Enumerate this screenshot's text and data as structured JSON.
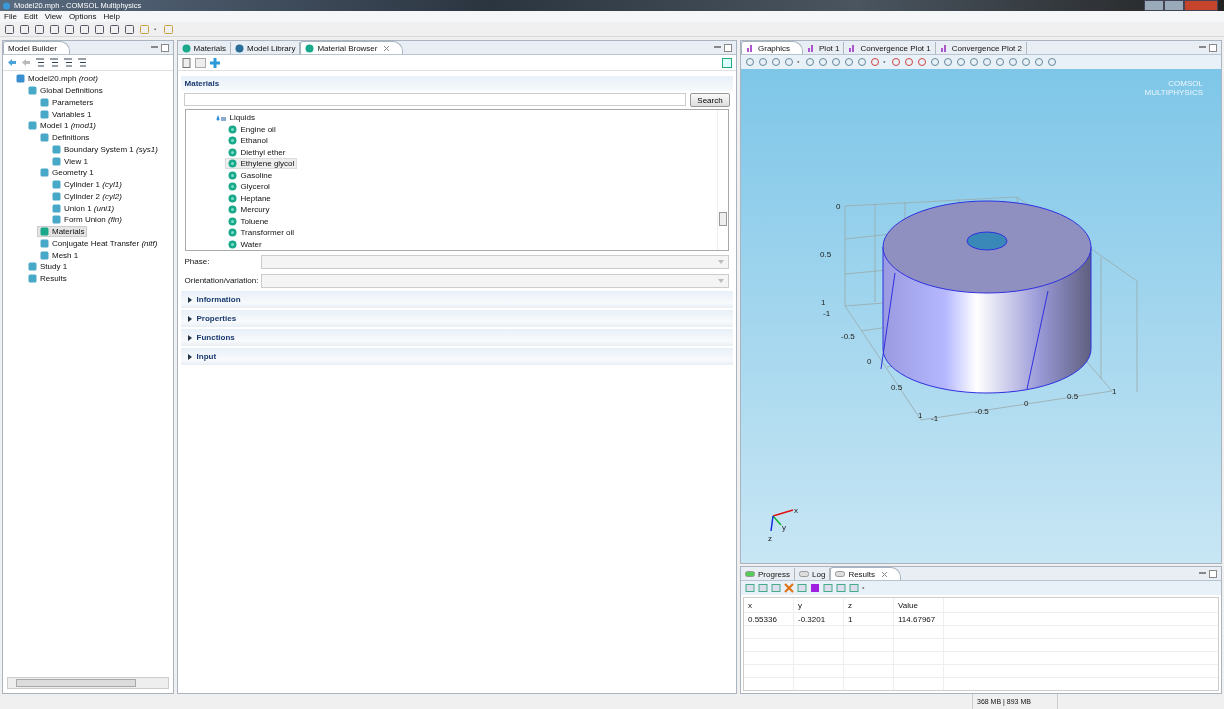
{
  "window": {
    "title": "Model20.mph - COMSOL Multiphysics"
  },
  "menu": [
    "File",
    "Edit",
    "View",
    "Options",
    "Help"
  ],
  "model_builder": {
    "tab": "Model Builder",
    "tree": [
      {
        "label": "Model20.mph *(root)*",
        "selected": false,
        "children": [
          {
            "label": "Global Definitions",
            "selected": false,
            "children": [
              {
                "label": "Parameters",
                "selected": false
              },
              {
                "label": "Variables 1",
                "selected": false
              }
            ]
          },
          {
            "label": "Model 1 *(mod1)*",
            "selected": false,
            "children": [
              {
                "label": "Definitions",
                "selected": false,
                "children": [
                  {
                    "label": "Boundary System 1 *(sys1)*",
                    "selected": false
                  },
                  {
                    "label": "View 1",
                    "selected": false
                  }
                ]
              },
              {
                "label": "Geometry 1",
                "selected": false,
                "children": [
                  {
                    "label": "Cylinder 1 *(cyl1)*",
                    "selected": false
                  },
                  {
                    "label": "Cylinder 2 *(cyl2)*",
                    "selected": false
                  },
                  {
                    "label": "Union 1 *(uni1)*",
                    "selected": false
                  },
                  {
                    "label": "Form Union *(fin)*",
                    "selected": false
                  }
                ]
              },
              {
                "label": "Materials",
                "selected": true
              },
              {
                "label": "Conjugate Heat Transfer *(nitf)*",
                "selected": false
              },
              {
                "label": "Mesh 1",
                "selected": false
              }
            ]
          },
          {
            "label": "Study 1",
            "selected": false
          },
          {
            "label": "Results",
            "selected": false
          }
        ]
      }
    ]
  },
  "editor": {
    "tabs": [
      {
        "label": "Materials",
        "selected": false,
        "closable": false
      },
      {
        "label": "Model Library",
        "selected": false,
        "closable": false
      },
      {
        "label": "Material Browser",
        "selected": true,
        "closable": true
      }
    ],
    "heading": "Materials",
    "search_button": "Search",
    "folder": "Liquids",
    "materials": [
      {
        "label": "Engine oil",
        "selected": false
      },
      {
        "label": "Ethanol",
        "selected": false
      },
      {
        "label": "Diethyl ether",
        "selected": false
      },
      {
        "label": "Ethylene glycol",
        "selected": true
      },
      {
        "label": "Gasoline",
        "selected": false
      },
      {
        "label": "Glycerol",
        "selected": false
      },
      {
        "label": "Heptane",
        "selected": false
      },
      {
        "label": "Mercury",
        "selected": false
      },
      {
        "label": "Toluene",
        "selected": false
      },
      {
        "label": "Transformer oil",
        "selected": false
      },
      {
        "label": "Water",
        "selected": false
      }
    ],
    "fields": [
      {
        "label": "Phase:"
      },
      {
        "label": "Orientation/variation:"
      }
    ],
    "sections": [
      {
        "label": "Information",
        "expanded": false
      },
      {
        "label": "Properties",
        "expanded": false
      },
      {
        "label": "Functions",
        "expanded": false
      },
      {
        "label": "Input",
        "expanded": false
      }
    ]
  },
  "graphics": {
    "tabs": [
      {
        "label": "Graphics",
        "selected": true
      },
      {
        "label": "Plot 1",
        "selected": false
      },
      {
        "label": "Convergence Plot 1",
        "selected": false
      },
      {
        "label": "Convergence Plot 2",
        "selected": false
      }
    ],
    "logo": [
      "COMSOL",
      "MULTIPHYSICS"
    ],
    "axis_labels": [
      "0",
      "0.5",
      "1",
      "-1",
      "-0.5",
      "0",
      "0.5",
      "1",
      "-1",
      "-0.5",
      "0",
      "0.5",
      "1"
    ],
    "triad": [
      "x",
      "y",
      "z"
    ]
  },
  "results": {
    "tabs": [
      {
        "label": "Progress",
        "selected": false,
        "closable": false
      },
      {
        "label": "Log",
        "selected": false,
        "closable": false
      },
      {
        "label": "Results",
        "selected": true,
        "closable": true
      }
    ],
    "columns": [
      "x",
      "y",
      "z",
      "Value"
    ],
    "rows": [
      [
        "0.55336",
        "-0.3201",
        "1",
        "114.67967"
      ]
    ]
  },
  "status_bar": {
    "memory": "368 MB | 893 MB"
  }
}
